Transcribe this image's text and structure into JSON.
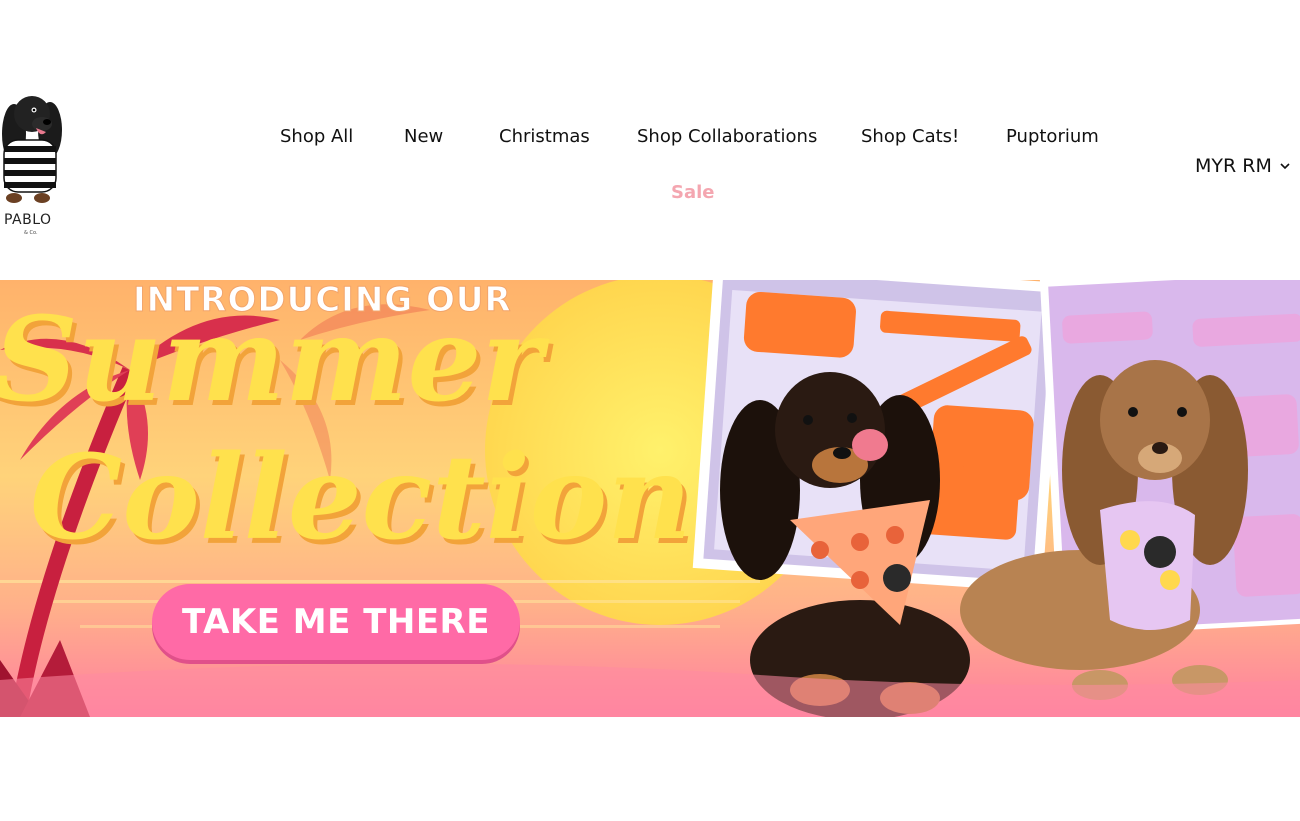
{
  "brand": {
    "logo_text": "PABLO",
    "logo_sub": "& Co."
  },
  "nav": {
    "items": [
      {
        "label": "Shop All"
      },
      {
        "label": "New"
      },
      {
        "label": "Christmas"
      },
      {
        "label": "Shop Collaborations"
      },
      {
        "label": "Shop Cats!"
      },
      {
        "label": "Puptorium"
      }
    ],
    "sale_label": "Sale",
    "sale_color": "#f4a6b0"
  },
  "currency": {
    "label": "MYR RM",
    "icon": "chevron-down-icon"
  },
  "hero": {
    "intro": "INTRODUCING OUR",
    "title_line1": "Summer",
    "title_line2": "Collection",
    "cta_label": "TAKE ME THERE",
    "colors": {
      "title": "#ffe14d",
      "cta": "#ff6aa6"
    }
  }
}
